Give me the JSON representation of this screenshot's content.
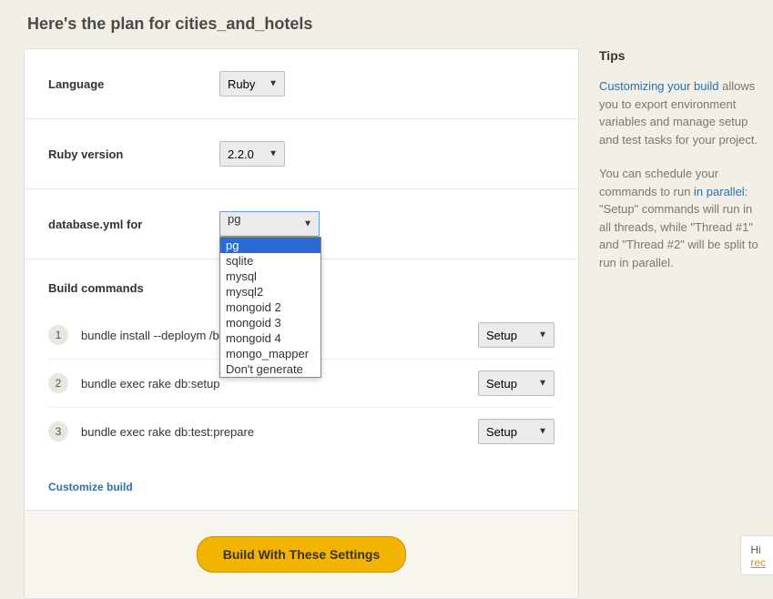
{
  "page": {
    "title": "Here's the plan for cities_and_hotels"
  },
  "form": {
    "language": {
      "label": "Language",
      "value": "Ruby"
    },
    "ruby_version": {
      "label": "Ruby version",
      "value": "2.2.0"
    },
    "database": {
      "label": "database.yml for",
      "value": "pg",
      "options": [
        "pg",
        "sqlite",
        "mysql",
        "mysql2",
        "mongoid 2",
        "mongoid 3",
        "mongoid 4",
        "mongo_mapper",
        "Don't generate"
      ]
    }
  },
  "commands": {
    "title": "Build commands",
    "items": [
      {
        "num": "1",
        "text": "bundle install --deploym                          /bundle",
        "type": "Setup"
      },
      {
        "num": "2",
        "text": "bundle exec rake db:setup",
        "type": "Setup"
      },
      {
        "num": "3",
        "text": "bundle exec rake db:test:prepare",
        "type": "Setup"
      }
    ],
    "customize": "Customize build"
  },
  "footer": {
    "build_label": "Build With These Settings"
  },
  "tips": {
    "title": "Tips",
    "p1_link": "Customizing your build",
    "p1_rest": " allows you to export environment variables and manage setup and test tasks for your project.",
    "p2_pre": "You can schedule your commands to run ",
    "p2_link": "in parallel",
    "p2_post": ": \"Setup\" commands will run in all threads, while \"Thread #1\" and \"Thread #2\" will be split to run in parallel."
  },
  "chat": {
    "line1": "Hi",
    "line2": "rec"
  }
}
